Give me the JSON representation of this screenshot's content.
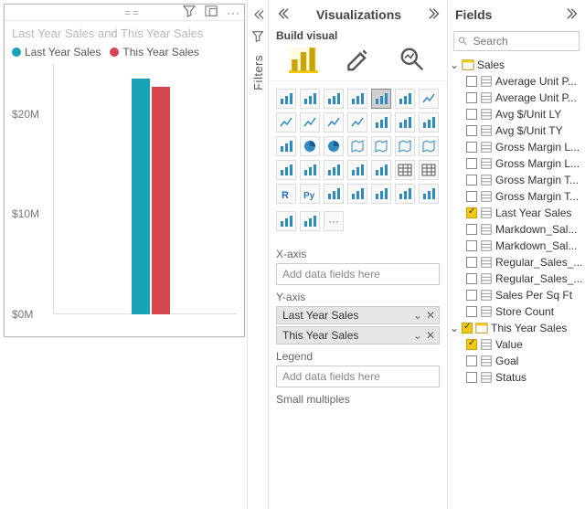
{
  "chart_data": {
    "type": "bar",
    "title": "Last Year Sales and This Year Sales",
    "categories": [
      ""
    ],
    "series": [
      {
        "name": "Last Year Sales",
        "values": [
          23500000
        ],
        "color": "#1aa2b8"
      },
      {
        "name": "This Year Sales",
        "values": [
          22700000
        ],
        "color": "#d64550"
      }
    ],
    "ylabel": "",
    "ylim": [
      0,
      25000000
    ],
    "yticks": [
      0,
      10000000,
      20000000
    ],
    "ytick_labels": [
      "$0M",
      "$10M",
      "$20M"
    ]
  },
  "filters_label": "Filters",
  "viz": {
    "title": "Visualizations",
    "subtitle": "Build visual",
    "gallery": [
      "stacked-bar",
      "clustered-bar",
      "stacked-bar-100",
      "stacked-column",
      "clustered-column",
      "stacked-column-100",
      "line",
      "area",
      "stacked-area",
      "line-stacked-column",
      "line-clustered-column",
      "ribbon",
      "waterfall",
      "funnel",
      "scatter",
      "pie",
      "donut",
      "treemap",
      "map",
      "filled-map",
      "azure-map",
      "gauge",
      "card",
      "multi-row-card",
      "kpi",
      "slicer",
      "table",
      "matrix",
      "r-visual",
      "py-visual",
      "key-influencers",
      "decomposition-tree",
      "q-and-a",
      "smart-narrative",
      "paginated-report",
      "arcgis",
      "power-apps",
      "ellipsis"
    ],
    "selected_gallery": "clustered-column",
    "wells": {
      "xaxis_label": "X-axis",
      "xaxis_placeholder": "Add data fields here",
      "yaxis_label": "Y-axis",
      "yaxis_items": [
        "Last Year Sales",
        "This Year Sales"
      ],
      "legend_label": "Legend",
      "legend_placeholder": "Add data fields here",
      "small_multiples_label": "Small multiples"
    }
  },
  "fields": {
    "title": "Fields",
    "search_placeholder": "Search",
    "tables": [
      {
        "name": "Sales",
        "expanded": true,
        "items": [
          {
            "name": "Average Unit P...",
            "checked": false
          },
          {
            "name": "Average Unit P...",
            "checked": false
          },
          {
            "name": "Avg $/Unit LY",
            "checked": false
          },
          {
            "name": "Avg $/Unit TY",
            "checked": false
          },
          {
            "name": "Gross Margin L...",
            "checked": false
          },
          {
            "name": "Gross Margin L...",
            "checked": false
          },
          {
            "name": "Gross Margin T...",
            "checked": false
          },
          {
            "name": "Gross Margin T...",
            "checked": false
          },
          {
            "name": "Last Year Sales",
            "checked": true
          },
          {
            "name": "Markdown_Sal...",
            "checked": false
          },
          {
            "name": "Markdown_Sal...",
            "checked": false
          },
          {
            "name": "Regular_Sales_...",
            "checked": false
          },
          {
            "name": "Regular_Sales_...",
            "checked": false
          },
          {
            "name": "Sales Per Sq Ft",
            "checked": false
          },
          {
            "name": "Store Count",
            "checked": false
          }
        ]
      },
      {
        "name": "This Year Sales",
        "expanded": true,
        "checked": true,
        "items": [
          {
            "name": "Value",
            "checked": true
          },
          {
            "name": "Goal",
            "checked": false
          },
          {
            "name": "Status",
            "checked": false
          }
        ]
      }
    ]
  }
}
